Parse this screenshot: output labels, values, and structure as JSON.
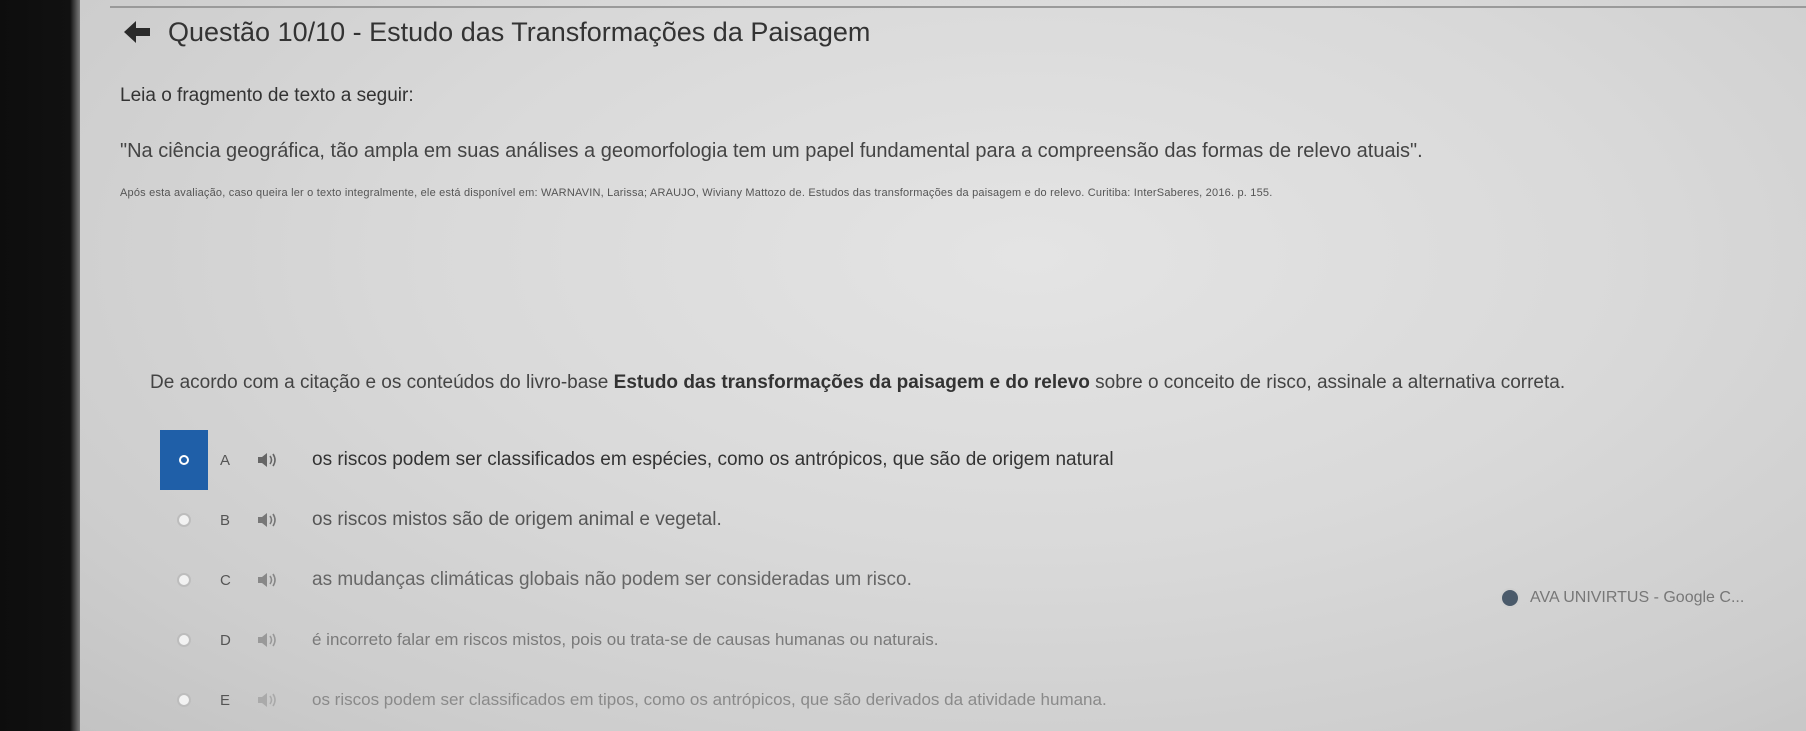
{
  "header": {
    "title": "Questão 10/10 - Estudo das Transformações da Paisagem"
  },
  "content": {
    "instruction": "Leia o fragmento de texto a seguir:",
    "quote": "\"Na ciência geográfica, tão ampla em suas análises a geomorfologia tem um papel fundamental para a compreensão das formas de relevo atuais\".",
    "citation": "Após esta avaliação, caso queira ler o texto integralmente, ele está disponível em: WARNAVIN, Larissa; ARAUJO, Wiviany Mattozo de. Estudos das transformações da paisagem e do relevo. Curitiba: InterSaberes, 2016. p. 155.",
    "question_prefix": "De acordo com a citação e os conteúdos do livro-base ",
    "question_book": "Estudo das transformações da paisagem e do relevo",
    "question_suffix": " sobre o conceito de risco, assinale a alternativa correta."
  },
  "options": [
    {
      "letter": "A",
      "text": "os riscos podem ser classificados em espécies, como os antrópicos, que são de origem natural",
      "selected": true
    },
    {
      "letter": "B",
      "text": "os riscos mistos são de origem animal e vegetal.",
      "selected": false
    },
    {
      "letter": "C",
      "text": "as mudanças climáticas globais não podem ser consideradas um risco.",
      "selected": false
    },
    {
      "letter": "D",
      "text": "é incorreto falar em riscos mistos, pois ou trata-se de causas humanas ou naturais.",
      "selected": false
    },
    {
      "letter": "E",
      "text": "os riscos podem ser classificados em tipos, como os antrópicos, que são derivados da atividade humana.",
      "selected": false
    }
  ],
  "taskbar_notice": {
    "label": "AVA UNIVIRTUS - Google C..."
  },
  "colors": {
    "selected_accent": "#1f5fa8"
  },
  "icons": {
    "back": "arrow-left-icon",
    "audio": "speaker-icon"
  }
}
